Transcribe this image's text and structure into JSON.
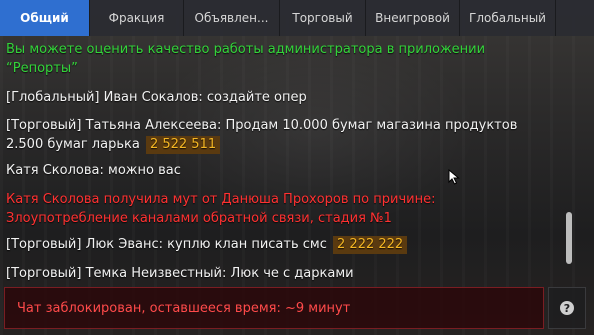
{
  "tabs": [
    {
      "label": "Общий",
      "active": true
    },
    {
      "label": "Фракция",
      "active": false
    },
    {
      "label": "Объявлен...",
      "active": false
    },
    {
      "label": "Торговый",
      "active": false
    },
    {
      "label": "Внеигровой",
      "active": false
    },
    {
      "label": "Глобальный",
      "active": false
    }
  ],
  "messages": [
    {
      "text": "Вы можете оценить качество работы администратора в приложении “Репорты”",
      "color": "#33d43a"
    },
    {
      "text": "[Глобальный] Иван Сокалов: создайте опер"
    },
    {
      "text": "[Торговый] Татьяна Алексеева: Продам 10.000 бумаг магазина продуктов 2.500 бумаг ларька",
      "amount": "2 522 511"
    },
    {
      "text": "Катя Сколова: можно вас"
    },
    {
      "text": "Катя Сколова получила мут от Данюша Прохоров по причине: Злоупотребление каналами обратной связи, стадия №1",
      "color": "#ff3131"
    },
    {
      "text": "[Торговый] Люк Эванс: куплю клан писать смс",
      "amount": "2 222 222"
    },
    {
      "text": "[Торговый] Темка Неизвестный: Люк че с дарками"
    }
  ],
  "input": {
    "text": "Чат заблокирован, оставшееся время: ~9 минут"
  },
  "help_button": {
    "glyph": "?",
    "icon": "help-icon"
  },
  "colors": {
    "active_tab": "#2f6fd0",
    "system_green": "#33d43a",
    "alert_red": "#ff3131",
    "amount_badge_bg": "#5a3a10",
    "amount_badge_text": "#f5b623"
  }
}
